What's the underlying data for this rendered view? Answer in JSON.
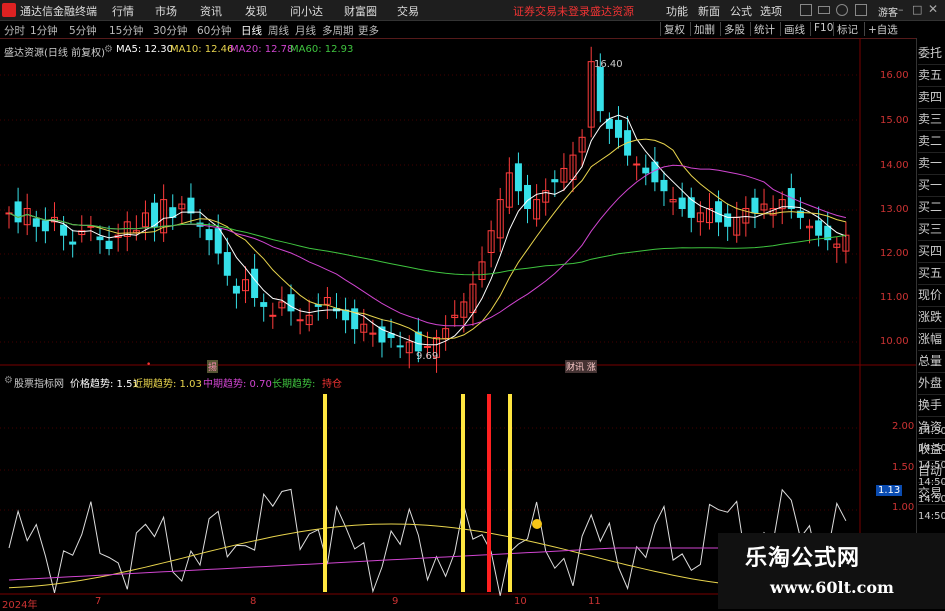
{
  "app": {
    "title": "通达信金融终端"
  },
  "menu": [
    "行情",
    "市场",
    "资讯",
    "发现",
    "问小达",
    "财富圈",
    "交易"
  ],
  "red_links": [
    "证券交易未登录",
    "盛达资源"
  ],
  "right_menu": [
    "功能",
    "新面",
    "公式",
    "选项"
  ],
  "guest": "游客",
  "toolbar": {
    "periods": [
      "分时",
      "1分钟",
      "5分钟",
      "15分钟",
      "30分钟",
      "60分钟",
      "日线",
      "周线",
      "月线",
      "多周期",
      "更多"
    ],
    "active": "日线",
    "right": [
      "复权",
      "加删",
      "多股",
      "统计",
      "画线",
      "F10",
      "标记",
      "+自选"
    ]
  },
  "main": {
    "title": "盛达资源(日线 前复权)",
    "ma": [
      {
        "label": "MA5: 12.30",
        "color": "#ffffff"
      },
      {
        "label": "MA10: 12.46",
        "color": "#e8d44d"
      },
      {
        "label": "MA20: 12.78",
        "color": "#d045d0"
      },
      {
        "label": "MA60: 12.93",
        "color": "#3fc43f"
      }
    ],
    "y_ticks": [
      "16.00",
      "15.00",
      "14.00",
      "13.00",
      "12.00",
      "11.00",
      "10.00"
    ],
    "high_label": "16.40",
    "low_label": "9.69",
    "markers": [
      "•",
      "揚",
      "财讯 涨"
    ]
  },
  "indicator": {
    "title": "股票指标网",
    "items": [
      {
        "label": "价格趋势: 1.51",
        "color": "#ffffff"
      },
      {
        "label": "近期趋势: 1.03",
        "color": "#e8d44d"
      },
      {
        "label": "中期趋势: 0.70",
        "color": "#d045d0"
      },
      {
        "label": "长期趋势:",
        "color": "#3fc43f"
      },
      {
        "label": "持仓",
        "color": "#e33"
      }
    ],
    "y_ticks": [
      "2.00",
      "1.50",
      "1.00"
    ],
    "current_value": "1.13"
  },
  "x_axis": [
    "2024年",
    "7",
    "8",
    "9",
    "10",
    "11"
  ],
  "side_panel": [
    "委托",
    "卖五",
    "卖四",
    "卖三",
    "卖二",
    "卖一",
    "买一",
    "买二",
    "买三",
    "买四",
    "买五",
    "现价",
    "涨跌",
    "涨幅",
    "总量",
    "外盘",
    "换手",
    "净资",
    "收益",
    "自动",
    "交易"
  ],
  "side_times": [
    "14:50",
    "14:50",
    "14:50",
    "14:50",
    "14:50",
    "14:50"
  ],
  "watermark": {
    "title": "乐淘公式网",
    "url": "www.60lt.com"
  }
}
